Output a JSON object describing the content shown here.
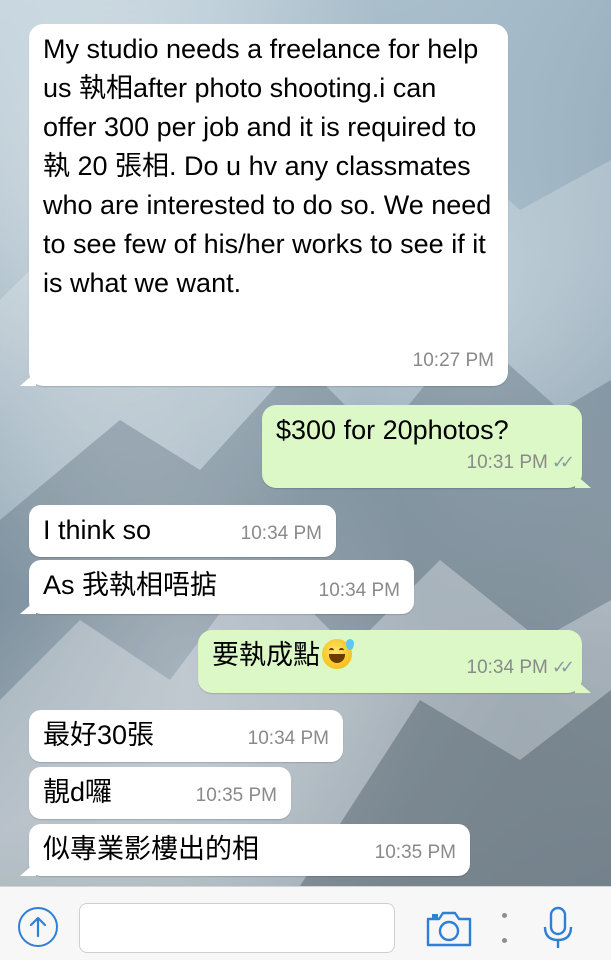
{
  "messages": [
    {
      "direction": "in",
      "text": "My studio needs a freelance for help us 執相after photo shooting.i can offer 300 per job and it is required to 執 20 張相. Do u hv any classmates who are interested to do so. We need to see few of his/her works to see if it is what we want.",
      "time": "10:27 PM"
    },
    {
      "direction": "out",
      "text": "$300 for 20photos?",
      "time": "10:31 PM",
      "status": "read-ticks"
    },
    {
      "direction": "in",
      "text": "I think so",
      "time": "10:34 PM"
    },
    {
      "direction": "in",
      "text": "As 我執相唔掂",
      "time": "10:34 PM"
    },
    {
      "direction": "out",
      "text": "要執成點",
      "emoji": "grinning-face-with-sweat",
      "time": "10:34 PM",
      "status": "read-ticks"
    },
    {
      "direction": "in",
      "text": "最好30張",
      "time": "10:34 PM"
    },
    {
      "direction": "in",
      "text": "靚d囉",
      "time": "10:35 PM"
    },
    {
      "direction": "in",
      "text": "似專業影樓出的相",
      "time": "10:35 PM"
    }
  ],
  "input_bar": {
    "upload_icon": "arrow-up-circle-icon",
    "message_value": "",
    "camera_icon": "camera-icon",
    "more_icon": "vertical-dots-icon",
    "mic_icon": "microphone-icon"
  },
  "colors": {
    "incoming_bubble": "#ffffff",
    "outgoing_bubble": "#dcf8c6",
    "accent": "#2f7fd6",
    "timestamp": "#8a8a8a"
  }
}
